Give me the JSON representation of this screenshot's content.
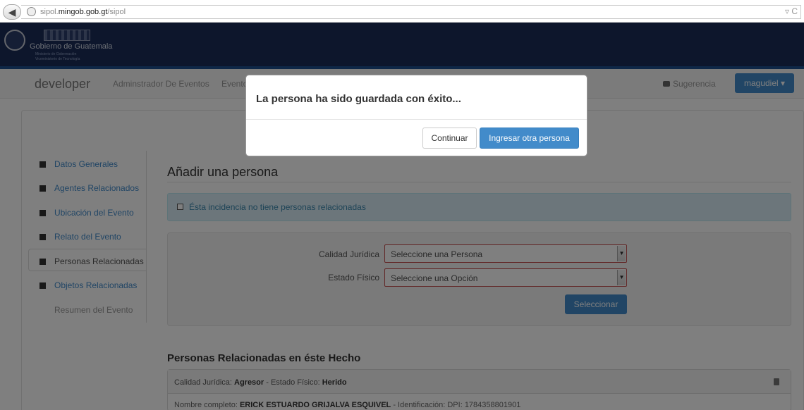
{
  "browser": {
    "url_prefix": "sipol.",
    "url_domain": "mingob.gob.gt",
    "url_path": "/sipol",
    "controls": "▿ C"
  },
  "gov_header": {
    "title": "Gobierno de Guatemala",
    "sub1": "Ministerio de Gobernación",
    "sub2": "Viceministerio de Tecnología"
  },
  "navbar": {
    "brand": "developer",
    "links": [
      "Adminstrador De Eventos",
      "Evento"
    ],
    "sugerencia": "Sugerencia",
    "user": "magudiel ▾"
  },
  "sidebar": {
    "items": [
      {
        "label": "Datos Generales",
        "icon": "flag-icon"
      },
      {
        "label": "Agentes Relacionados",
        "icon": "bell-icon"
      },
      {
        "label": "Ubicación del Evento",
        "icon": "map-marker-icon"
      },
      {
        "label": "Relato del Evento",
        "icon": "list-icon"
      },
      {
        "label": "Personas Relacionadas",
        "icon": "user-icon"
      },
      {
        "label": "Objetos Relacionadas",
        "icon": "briefcase-icon"
      },
      {
        "label": "Resumen del Evento",
        "icon": ""
      }
    ],
    "active_index": 4
  },
  "content": {
    "title": "Añadir una persona",
    "alert_text": "Ésta incidencia no tiene personas relacionadas",
    "form": {
      "calidad_label": "Calidad Jurídica",
      "calidad_value": "Seleccione una Persona",
      "estado_label": "Estado Físico",
      "estado_value": "Seleccione una Opción",
      "select_button": "Seleccionar"
    },
    "section_title": "Personas Relacionadas en éste Hecho",
    "person": {
      "calidad_label": "Calidad Jurídica:",
      "calidad_value": "Agresor",
      "estado_label": "- Estado Físico:",
      "estado_value": "Herido",
      "nombre_label": "Nombre completo:",
      "nombre_value": "ERICK ESTUARDO GRIJALVA ESQUIVEL",
      "id_text": "- Identificación: DPI: 1784358801901"
    }
  },
  "modal": {
    "message": "La persona ha sido guardada con éxito...",
    "continue_label": "Continuar",
    "another_label": "Ingresar otra persona"
  }
}
